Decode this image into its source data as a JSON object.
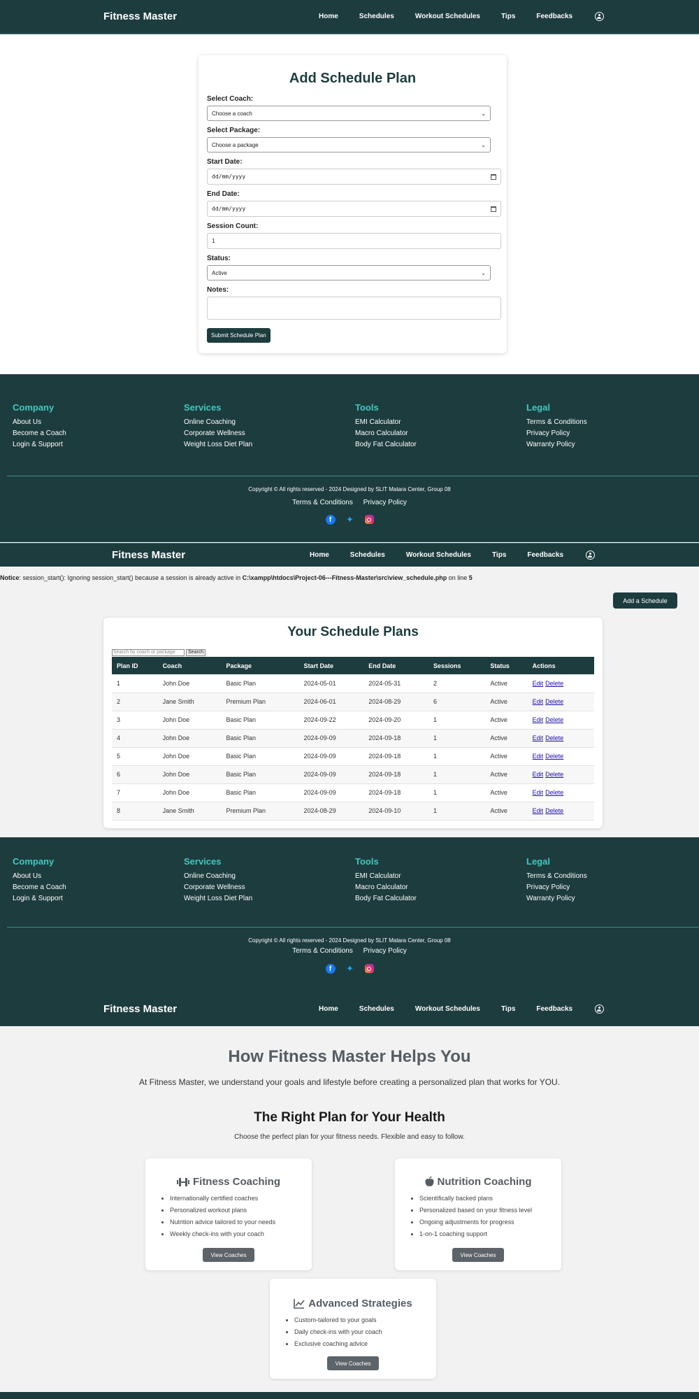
{
  "nav": {
    "brand": "Fitness Master",
    "links": [
      "Home",
      "Schedules",
      "Workout Schedules",
      "Tips",
      "Feedbacks"
    ],
    "user_icon": "user-circle-icon"
  },
  "form": {
    "title": "Add Schedule Plan",
    "coach_label": "Select Coach:",
    "coach_value": "Choose a coach",
    "package_label": "Select Package:",
    "package_value": "Choose a package",
    "start_label": "Start Date:",
    "start_value": "dd/mm/yyyy",
    "end_label": "End Date:",
    "end_value": "dd/mm/yyyy",
    "session_label": "Session Count:",
    "session_value": "1",
    "status_label": "Status:",
    "status_value": "Active",
    "notes_label": "Notes:",
    "submit_label": "Submit Schedule Plan"
  },
  "footer": {
    "columns": [
      {
        "title": "Company",
        "items": [
          "About Us",
          "Become a Coach",
          "Login & Support"
        ]
      },
      {
        "title": "Services",
        "items": [
          "Online Coaching",
          "Corporate Wellness",
          "Weight Loss Diet Plan"
        ]
      },
      {
        "title": "Tools",
        "items": [
          "EMI Calculator",
          "Macro Calculator",
          "Body Fat Calculator"
        ]
      },
      {
        "title": "Legal",
        "items": [
          "Terms & Conditions",
          "Privacy Policy",
          "Warranty Policy"
        ]
      }
    ],
    "copyright": "Copyright © All rights reserved - 2024 Designed by SLIT Matara Center, Group 08",
    "links": [
      "Terms & Conditions",
      "Privacy Policy"
    ],
    "social": [
      "facebook-icon",
      "twitter-icon",
      "instagram-icon"
    ],
    "title_color": "#3fc9c0"
  },
  "notice": {
    "label": "Notice",
    "text": ": session_start(): Ignoring session_start() because a session is already active in ",
    "path": "C:\\xampp\\htdocs\\Project-06---Fitness-Master\\src\\view_schedule.php",
    "mid": " on line ",
    "line": "5"
  },
  "schedules": {
    "add_button": "Add a Schedule",
    "title": "Your Schedule Plans",
    "search_placeholder": "Search by coach or package",
    "search_button": "Search",
    "columns": [
      "Plan ID",
      "Coach",
      "Package",
      "Start Date",
      "End Date",
      "Sessions",
      "Status",
      "Actions"
    ],
    "edit_label": "Edit",
    "delete_label": "Delete",
    "rows": [
      [
        "1",
        "John Doe",
        "Basic Plan",
        "2024-05-01",
        "2024-05-31",
        "2",
        "Active"
      ],
      [
        "2",
        "Jane Smith",
        "Premium Plan",
        "2024-06-01",
        "2024-08-29",
        "6",
        "Active"
      ],
      [
        "3",
        "John Doe",
        "Basic Plan",
        "2024-09-22",
        "2024-09-20",
        "1",
        "Active"
      ],
      [
        "4",
        "John Doe",
        "Basic Plan",
        "2024-09-09",
        "2024-09-18",
        "1",
        "Active"
      ],
      [
        "5",
        "John Doe",
        "Basic Plan",
        "2024-09-09",
        "2024-09-18",
        "1",
        "Active"
      ],
      [
        "6",
        "John Doe",
        "Basic Plan",
        "2024-09-09",
        "2024-09-18",
        "1",
        "Active"
      ],
      [
        "7",
        "John Doe",
        "Basic Plan",
        "2024-09-09",
        "2024-09-18",
        "1",
        "Active"
      ],
      [
        "8",
        "Jane Smith",
        "Premium Plan",
        "2024-08-29",
        "2024-09-10",
        "1",
        "Active"
      ]
    ]
  },
  "help": {
    "title": "How Fitness Master Helps You",
    "lead": "At Fitness Master, we understand your goals and lifestyle before creating a personalized plan that works for YOU.",
    "plans_title": "The Right Plan for Your Health",
    "plans_sub": "Choose the perfect plan for your fitness needs. Flexible and easy to follow.",
    "button_label": "View Coaches",
    "cards": [
      {
        "title": "Fitness Coaching",
        "icon": "dumbbell-icon",
        "items": [
          "Internationally certified coaches",
          "Personalized workout plans",
          "Nutrition advice tailored to your needs",
          "Weekly check-ins with your coach"
        ]
      },
      {
        "title": "Nutrition Coaching",
        "icon": "apple-icon",
        "items": [
          "Scientifically backed plans",
          "Personalized based on your fitness level",
          "Ongoing adjustments for progress",
          "1-on-1 coaching support"
        ]
      },
      {
        "title": "Advanced Strategies",
        "icon": "chart-line-icon",
        "items": [
          "Custom-tailored to your goals",
          "Daily check-ins with your coach",
          "Exclusive coaching advice"
        ]
      }
    ]
  },
  "colors": {
    "primary": "#1d3c3e",
    "accent": "#3fc9c0",
    "button_gray": "#5c6369"
  }
}
